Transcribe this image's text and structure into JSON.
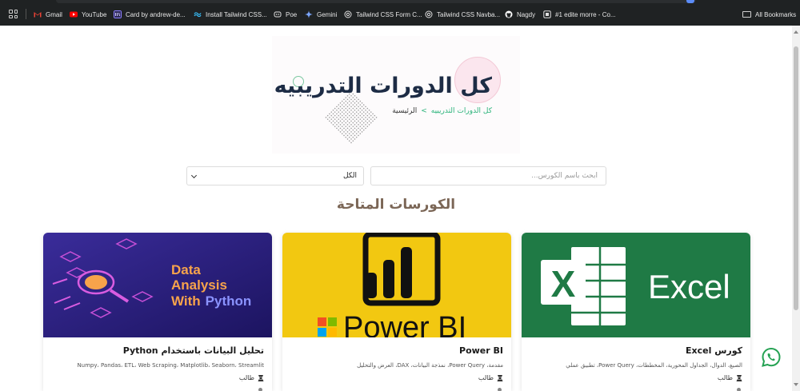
{
  "bookmarks": [
    {
      "label": "Gmail",
      "icon": "gmail-icon",
      "color": "#ea4335"
    },
    {
      "label": "YouTube",
      "icon": "youtube-icon",
      "color": "#ff0000"
    },
    {
      "label": "Card by andrew-de...",
      "icon": "card-icon",
      "color": "#6b5cff"
    },
    {
      "label": "Install Tailwind CSS...",
      "icon": "tailwind-icon",
      "color": "#38bdf8"
    },
    {
      "label": "Poe",
      "icon": "poe-icon",
      "color": "#e0e0e0"
    },
    {
      "label": "Gemini",
      "icon": "gemini-icon",
      "color": "#7ba6ff"
    },
    {
      "label": "Tailwind CSS Form C...",
      "icon": "globe-icon",
      "color": "#e0e0e0"
    },
    {
      "label": "Tailwind CSS Navba...",
      "icon": "globe-icon",
      "color": "#e0e0e0"
    },
    {
      "label": "Nagdy",
      "icon": "github-icon",
      "color": "#ffffff"
    },
    {
      "label": "#1 edite morre - Co...",
      "icon": "site-icon",
      "color": "#e0e0e0"
    }
  ],
  "all_bookmarks_label": "All Bookmarks",
  "hero": {
    "title": "كل الدورات التدريبيه",
    "breadcrumb_home": "الرئيسية",
    "breadcrumb_separator": ">",
    "breadcrumb_current": "كل الدورات التدريبيه"
  },
  "filters": {
    "search_placeholder": "ابحث باسم الكورس...",
    "category_value": "الكل"
  },
  "section_title": "الكورسات المتاحة",
  "courses": [
    {
      "title": "كورس Excel",
      "tags": "الصيغ، الدوال، الجداول المحورية، المخططات، Power Query، تطبيق عملي",
      "audience": "طالب",
      "thumbnail_text": "Excel",
      "thumbnail_color": "#1f7a45"
    },
    {
      "title": "Power BI",
      "tags": "مقدمة، Power Query، نمذجة البيانات، DAX، العرض والتحليل",
      "audience": "طالب",
      "thumbnail_text": "Power BI",
      "thumbnail_color": "#f2c811"
    },
    {
      "title": "تحليل البيانات باستخدام Python",
      "tags": "Numpy، Pandas، ETL، Web Scraping، Matplotlib، Seaborn، Streamlit",
      "audience": "طالب",
      "thumbnail_text_line1": "Data",
      "thumbnail_text_line2": "Analysis",
      "thumbnail_text_line3": "With",
      "thumbnail_text_line4": "Python",
      "thumbnail_color": "#2e1f7a"
    }
  ]
}
